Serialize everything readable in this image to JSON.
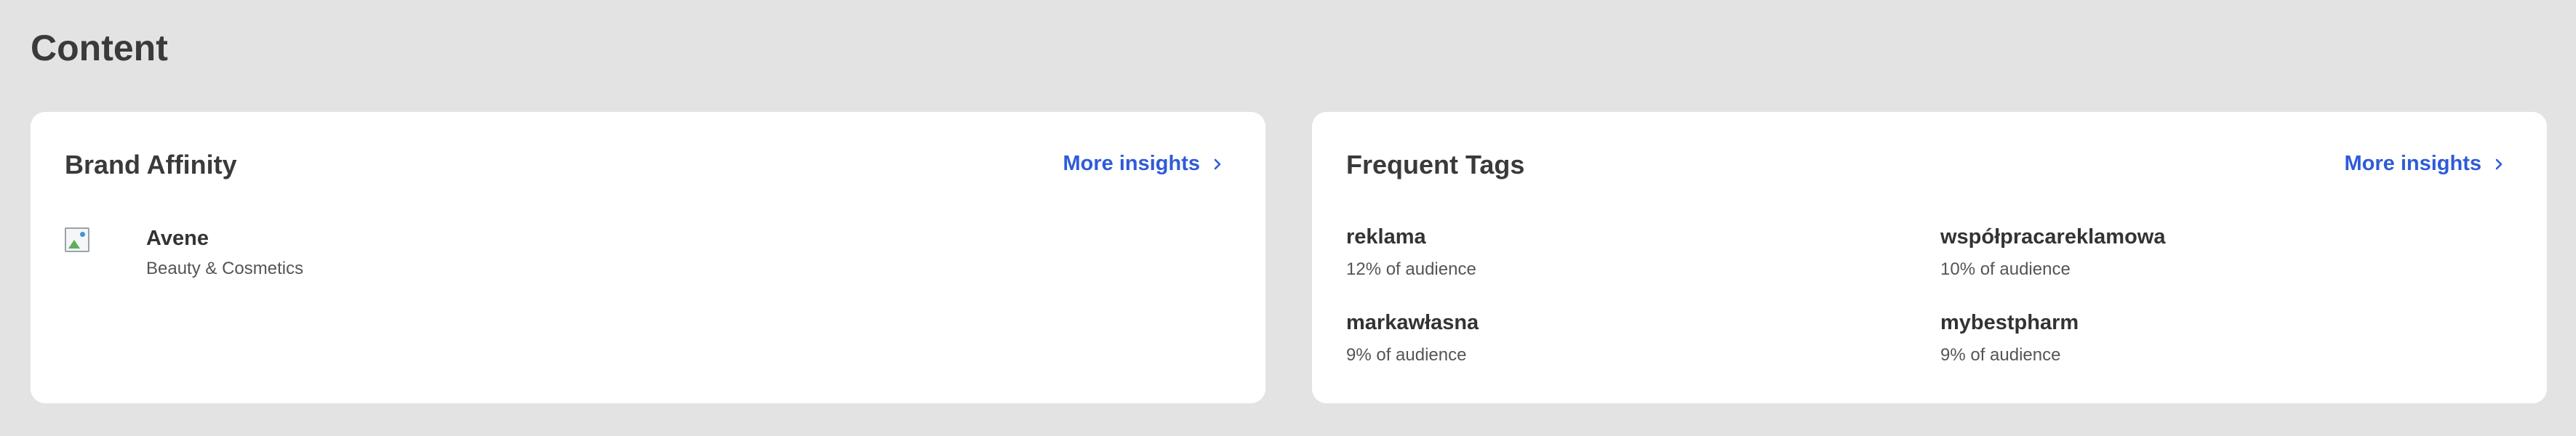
{
  "section": {
    "title": "Content"
  },
  "brand_affinity": {
    "title": "Brand Affinity",
    "more_link": "More insights",
    "brands": [
      {
        "name": "Avene",
        "category": "Beauty & Cosmetics",
        "logo_icon": "broken-image-icon"
      }
    ]
  },
  "frequent_tags": {
    "title": "Frequent Tags",
    "more_link": "More insights",
    "tags": [
      {
        "name": "reklama",
        "share": "12% of audience"
      },
      {
        "name": "współpracareklamowa",
        "share": "10% of audience"
      },
      {
        "name": "markawłasna",
        "share": "9% of audience"
      },
      {
        "name": "mybestpharm",
        "share": "9% of audience"
      }
    ]
  },
  "colors": {
    "background": "#e3e3e3",
    "card": "#ffffff",
    "link": "#2f5bd9",
    "text": "#333333"
  }
}
